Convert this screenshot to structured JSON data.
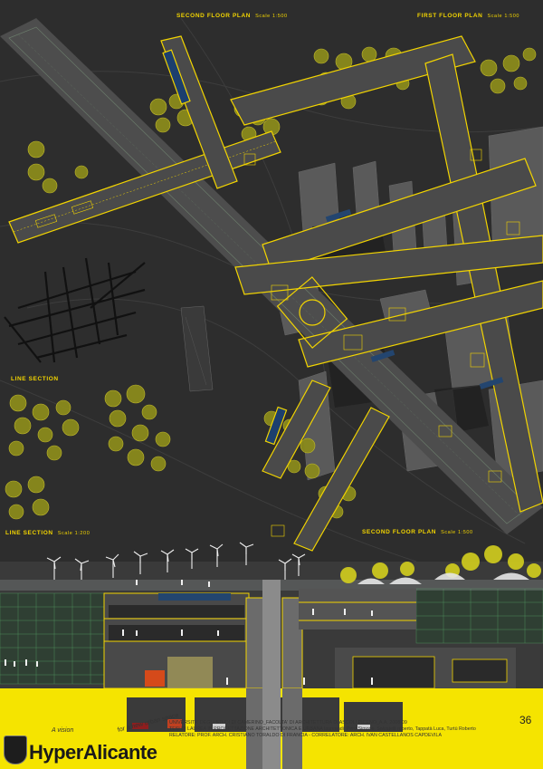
{
  "labels": {
    "second_floor_top": {
      "title": "SECOND FLOOR PLAN",
      "scale": "Scale 1:500"
    },
    "first_floor": {
      "title": "FIRST FLOOR PLAN",
      "scale": "Scale 1:500"
    },
    "line_section_1": {
      "title": "LINE SECTION"
    },
    "line_section_2": {
      "title": "LINE SECTION",
      "scale": "Scale 1:200"
    },
    "second_floor_bottom": {
      "title": "SECOND FLOOR PLAN",
      "scale": "Scale 1:500"
    }
  },
  "footer": {
    "tagline_a": "A vision",
    "tagline_b": "for a new urban space",
    "brand": "HyperAlicante",
    "page_number": "36",
    "credits": [
      "UNIVERSITA' DEGLI STUDI DI CAMERINO_FACOLTA' DI ARCHITETTURA DI ASCOLI PICENO_A.A. 2008-09",
      "TESI DI LAUREA IN PROGETTAZIONE ARCHITETTONICA E URBANA laureandi: Pirro Simone, Salvatelli roberto, Tappatà Luca, Turtù Roberto",
      "RELATORE: PROF. ARCH. CRISTIANO TORALDO DI FRANCIA  -  CORRELATORE: ARCH. IVAN CASTELLANOS CAPDEVILA"
    ]
  },
  "colors": {
    "background": "#2d2d2d",
    "accent_yellow": "#f2d400",
    "footer_yellow": "#f5e400",
    "tree_olive": "#8a8a1c",
    "building_grey": "#5a5a5a",
    "street_grey": "#4d4d4d"
  }
}
